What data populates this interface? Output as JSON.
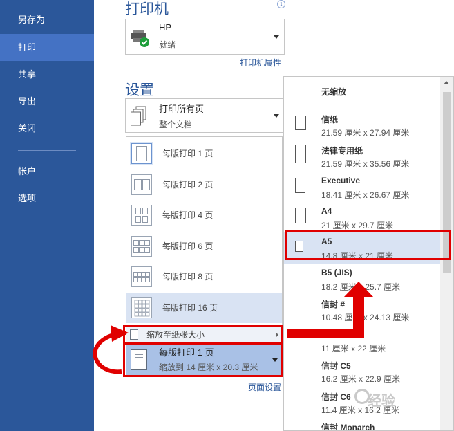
{
  "sidebar": {
    "items": [
      {
        "label": "另存为"
      },
      {
        "label": "打印",
        "active": true
      },
      {
        "label": "共享"
      },
      {
        "label": "导出"
      },
      {
        "label": "关闭"
      },
      {
        "label": "帐户"
      },
      {
        "label": "选项"
      }
    ]
  },
  "printer": {
    "heading": "打印机",
    "name": "HP",
    "status": "就绪",
    "properties_link": "打印机属性"
  },
  "settings": {
    "heading": "设置",
    "pages_dropdown": {
      "line1": "打印所有页",
      "line2": "整个文档"
    },
    "page_setup_link": "页面设置"
  },
  "pages_per_sheet": {
    "options": [
      {
        "label": "每版打印 1 页"
      },
      {
        "label": "每版打印 2 页"
      },
      {
        "label": "每版打印 4 页"
      },
      {
        "label": "每版打印 6 页"
      },
      {
        "label": "每版打印 8 页"
      },
      {
        "label": "每版打印 16 页"
      }
    ],
    "scale_to_paper": "缩放至纸张大小",
    "current": {
      "line1": "每版打印 1 页",
      "line2": "缩放到 14 厘米 x 20.3 厘米"
    }
  },
  "paper_sizes": {
    "items": [
      {
        "name": "无缩放",
        "size": ""
      },
      {
        "name": "信纸",
        "size": "21.59 厘米 x 27.94 厘米"
      },
      {
        "name": "法律专用纸",
        "size": "21.59 厘米 x 35.56 厘米"
      },
      {
        "name": "Executive",
        "size": "18.41 厘米 x 26.67 厘米"
      },
      {
        "name": "A4",
        "size": "21 厘米 x 29.7 厘米"
      },
      {
        "name": "A5",
        "size": "14.8 厘米 x 21 厘米"
      },
      {
        "name": "B5 (JIS)",
        "size": "18.2 厘米 x 25.7 厘米"
      },
      {
        "name": "信封 #",
        "size": "10.48 厘米 x 24.13 厘米"
      },
      {
        "name": "",
        "size": "11 厘米 x 22 厘米"
      },
      {
        "name": "信封 C5",
        "size": "16.2 厘米 x 22.9 厘米"
      },
      {
        "name": "信封 C6",
        "size": "11.4 厘米 x 16.2 厘米"
      },
      {
        "name": "信封 Monarch",
        "size": ""
      }
    ]
  },
  "watermark": {
    "text": "经验"
  },
  "colors": {
    "sidebar": "#2b579a",
    "accent": "#2b579a",
    "highlight": "#d9e3f3",
    "annotation": "#e00000"
  }
}
